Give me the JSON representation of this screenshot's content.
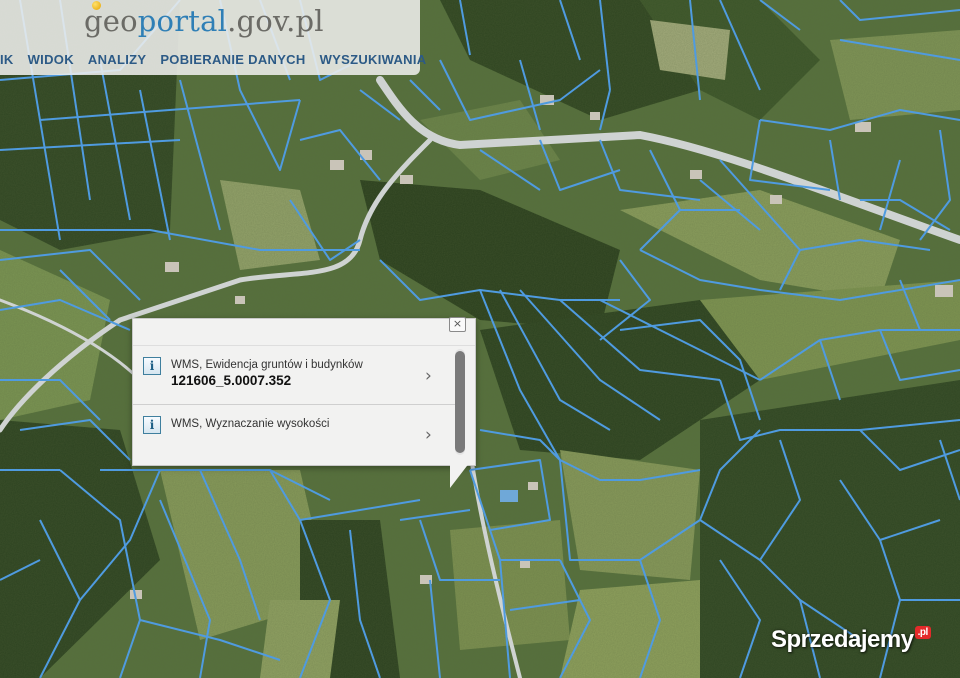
{
  "header": {
    "logo_prefix": "geo",
    "logo_main": "portal",
    "logo_suffix": ".gov.pl",
    "menu": [
      {
        "label": "IK"
      },
      {
        "label": "WIDOK"
      },
      {
        "label": "ANALIZY"
      },
      {
        "label": "POBIERANIE DANYCH"
      },
      {
        "label": "WYSZUKIWANIA"
      }
    ]
  },
  "popup": {
    "close_glyph": "×",
    "items": [
      {
        "icon": "info-icon",
        "title": "WMS, Ewidencja gruntów i budynków",
        "value": "121606_5.0007.352",
        "chevron": "›"
      },
      {
        "icon": "info-icon",
        "title": "WMS, Wyznaczanie wysokości",
        "value": "",
        "chevron": "›"
      }
    ]
  },
  "watermark": {
    "text": "Sprzedajemy",
    "badge": ".pl"
  },
  "colors": {
    "parcel_lines": "#4f9be0",
    "road": "#d7d9da",
    "menu_text": "#2c5a86",
    "logo_accent": "#2f7fb6"
  }
}
